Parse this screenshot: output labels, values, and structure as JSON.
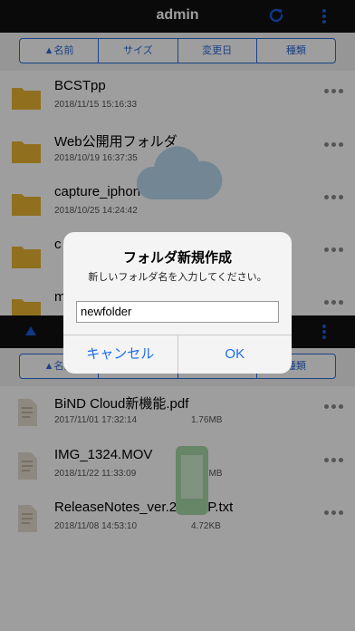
{
  "navbar": {
    "title": "admin",
    "refresh_icon": "refresh-icon",
    "menu_icon": "more-vertical-icon"
  },
  "sort": {
    "options": [
      "▲名前",
      "サイズ",
      "変更日",
      "種類"
    ]
  },
  "folders": [
    {
      "name": "BCSTpp",
      "date": "2018/11/15 15:16:33"
    },
    {
      "name": "Web公開用フォルダ",
      "date": "2018/10/19 16:37:35"
    },
    {
      "name": "capture_iphone",
      "date": "2018/10/25 14:24:42"
    },
    {
      "name": "c",
      "date": ""
    },
    {
      "name": "m",
      "date": ""
    }
  ],
  "pane2": {
    "sort_visible": [
      "▲名前",
      "",
      "",
      "種類"
    ],
    "files": [
      {
        "name": "BiND Cloud新機能.pdf",
        "date": "2017/11/01 17:32:14",
        "size": "1.76MB"
      },
      {
        "name": "IMG_1324.MOV",
        "date": "2018/11/22 11:33:09",
        "size": "7.89MB"
      },
      {
        "name": "ReleaseNotes_ver.2-HTTP.txt",
        "date": "2018/11/08 14:53:10",
        "size": "4.72KB"
      }
    ]
  },
  "dialog": {
    "title": "フォルダ新規作成",
    "message": "新しいフォルダ名を入力してください。",
    "input_value": "newfolder",
    "cancel_label": "キャンセル",
    "ok_label": "OK"
  },
  "colors": {
    "accent": "#1a6ef0",
    "folder": "#e9b532",
    "navbar": "#111111"
  }
}
